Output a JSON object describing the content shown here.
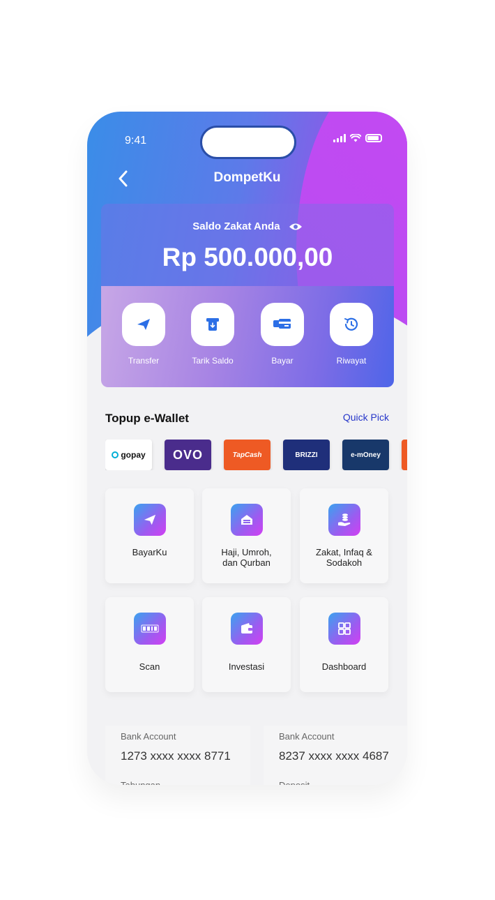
{
  "status": {
    "time": "9:41"
  },
  "nav": {
    "title": "DompetKu"
  },
  "balance": {
    "label": "Saldo Zakat Anda",
    "amount": "Rp 500.000,00"
  },
  "actions": [
    {
      "label": "Transfer",
      "icon": "send-icon"
    },
    {
      "label": "Tarik Saldo",
      "icon": "withdraw-icon"
    },
    {
      "label": "Bayar",
      "icon": "pay-icon"
    },
    {
      "label": "Riwayat",
      "icon": "history-icon"
    }
  ],
  "topup": {
    "title": "Topup e-Wallet",
    "quick_pick": "Quick Pick",
    "wallets": [
      "gopay",
      "OVO",
      "TapCash",
      "BRIZZI",
      "e-mOney"
    ]
  },
  "menu": [
    {
      "label": "BayarKu",
      "icon": "send-icon"
    },
    {
      "label": "Haji, Umroh, dan Qurban",
      "icon": "mosque-icon"
    },
    {
      "label": "Zakat, Infaq & Sodakoh",
      "icon": "donation-icon"
    },
    {
      "label": "Scan",
      "icon": "qris-icon"
    },
    {
      "label": "Investasi",
      "icon": "wallet-icon"
    },
    {
      "label": "Dashboard",
      "icon": "dashboard-icon"
    }
  ],
  "accounts": [
    {
      "label": "Bank Account",
      "number": "1273 xxxx xxxx 8771",
      "type": "Tabungan"
    },
    {
      "label": "Bank Account",
      "number": "8237 xxxx xxxx 4687",
      "type": "Deposit"
    }
  ],
  "colors": {
    "accent": "#2535c9",
    "gradient_start": "#3a8de8",
    "gradient_end": "#c54cf0"
  }
}
